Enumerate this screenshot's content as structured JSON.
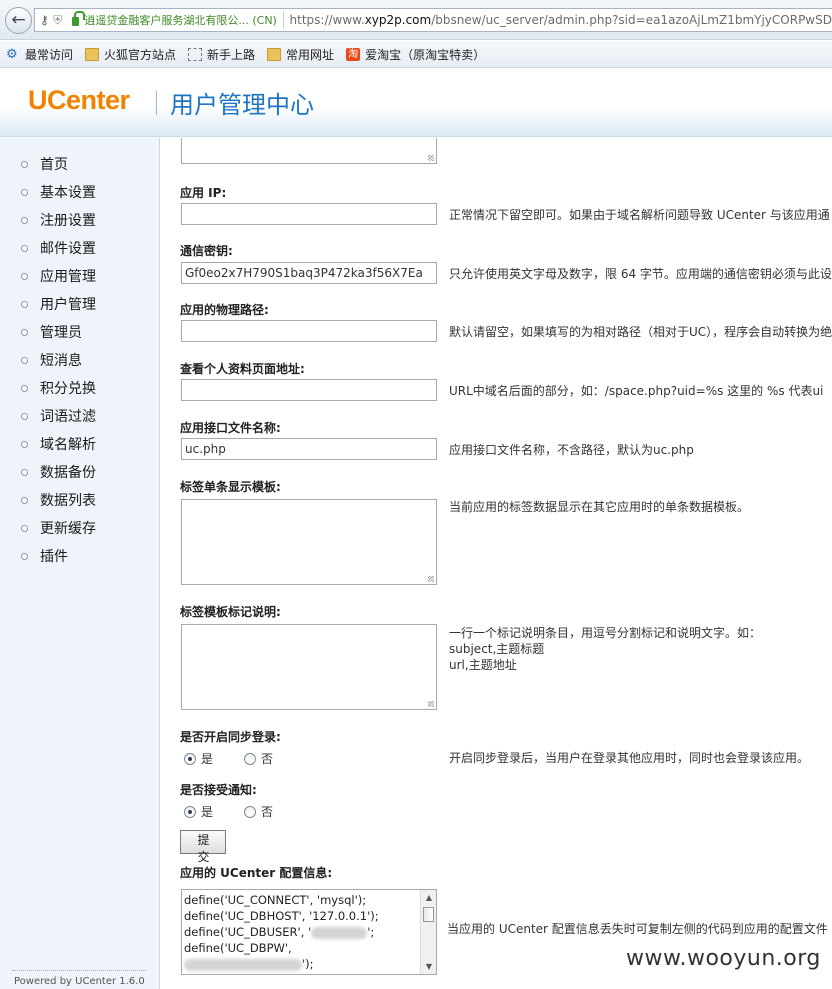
{
  "browser": {
    "identity": "逍遥贷金融客户服务湖北有限公... (CN)",
    "url_prefix": "https://www.",
    "url_domain": "xyp2p.com",
    "url_rest": "/bbsnew/uc_server/admin.php?sid=ea1azoAjLmZ1bmYjyCORPwSD",
    "bookmarks": [
      "最常访问",
      "火狐官方站点",
      "新手上路",
      "常用网址",
      "爱淘宝（原淘宝特卖）"
    ]
  },
  "header": {
    "logo": "UCenter",
    "title": "用户管理中心"
  },
  "sidebar": {
    "items": [
      "首页",
      "基本设置",
      "注册设置",
      "邮件设置",
      "应用管理",
      "用户管理",
      "管理员",
      "短消息",
      "积分兑换",
      "词语过滤",
      "域名解析",
      "数据备份",
      "数据列表",
      "更新缓存",
      "插件"
    ],
    "powered": "Powered by UCenter 1.6.0"
  },
  "form": {
    "app_ip": {
      "label": "应用 IP:",
      "value": "",
      "hint": "正常情况下留空即可。如果由于域名解析问题导致 UCenter 与该应用通"
    },
    "comm_key": {
      "label": "通信密钥:",
      "value": "Gf0eo2x7H790S1baq3P472ka3f56X7Ea",
      "hint": "只允许使用英文字母及数字，限 64 字节。应用端的通信密钥必须与此设"
    },
    "path": {
      "label": "应用的物理路径:",
      "value": "",
      "hint": "默认请留空，如果填写的为相对路径（相对于UC），程序会自动转换为绝"
    },
    "profile_url": {
      "label": "查看个人资料页面地址:",
      "value": "",
      "hint": "URL中域名后面的部分，如：/space.php?uid=%s 这里的 %s 代表ui"
    },
    "api_file": {
      "label": "应用接口文件名称:",
      "value": "uc.php",
      "hint": "应用接口文件名称，不含路径，默认为uc.php"
    },
    "tag_template": {
      "label": "标签单条显示模板:",
      "hint": "当前应用的标签数据显示在其它应用时的单条数据模板。"
    },
    "tag_desc": {
      "label": "标签模板标记说明:",
      "hint1": "一行一个标记说明条目，用逗号分割标记和说明文字。如：",
      "hint2": "subject,主题标题",
      "hint3": "url,主题地址"
    },
    "sync_login": {
      "label": "是否开启同步登录:",
      "yes": "是",
      "no": "否",
      "selected": "yes",
      "hint": "开启同步登录后，当用户在登录其他应用时，同时也会登录该应用。"
    },
    "notify": {
      "label": "是否接受通知:",
      "yes": "是",
      "no": "否",
      "selected": "yes"
    },
    "submit_label": "提 交",
    "config": {
      "label": "应用的 UCenter 配置信息:",
      "lines": [
        "define('UC_CONNECT', 'mysql');",
        "define('UC_DBHOST', '127.0.0.1');",
        "define('UC_DBUSER', '",
        "define('UC_DBPW', ",
        "');"
      ],
      "hint": "当应用的 UCenter 配置信息丢失时可复制左侧的代码到应用的配置文件"
    }
  },
  "watermark": "www.wooyun.org"
}
